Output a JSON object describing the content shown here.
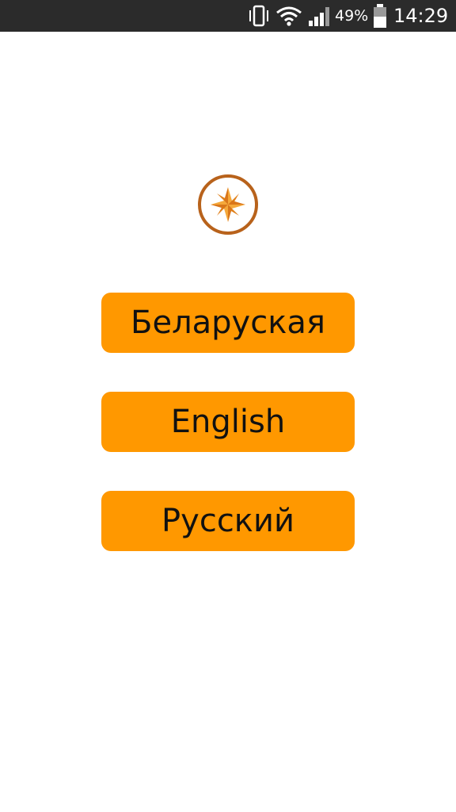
{
  "status_bar": {
    "icons": [
      "vibrate-icon",
      "wifi-icon",
      "signal-icon",
      "battery-icon"
    ],
    "battery_percent": "49%",
    "time": "14:29"
  },
  "logo": {
    "icon": "compass-star-icon",
    "ring_color": "#b8621b",
    "star_color": "#f29a1d"
  },
  "languages": {
    "belarusian": "Беларуская",
    "english": "English",
    "russian": "Русский"
  },
  "colors": {
    "button_background": "#ff9800",
    "button_text": "#111111",
    "status_bar_background": "#2b2b2b",
    "page_background": "#ffffff"
  }
}
